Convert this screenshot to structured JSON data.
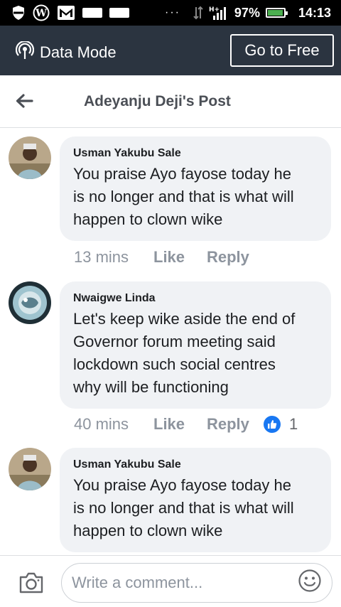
{
  "status_bar": {
    "dots": "···",
    "network": "H+",
    "battery": "97%",
    "battery_level": 0.97,
    "time": "14:13"
  },
  "data_mode": {
    "label": "Data Mode",
    "go_free_label": "Go to Free"
  },
  "header": {
    "title": "Adeyanju Deji's Post"
  },
  "comments": [
    {
      "author": "Usman Yakubu Sale",
      "text_lines": [
        "You praise Ayo fayose today he",
        "is no longer and that is what will",
        "happen to clown wike"
      ],
      "time": "13 mins",
      "like_label": "Like",
      "reply_label": "Reply"
    },
    {
      "author": "Nwaigwe Linda",
      "text_lines": [
        "Let's keep wike aside the end of",
        "Governor forum meeting said",
        "lockdown such social centres",
        "why will be functioning"
      ],
      "time": "40 mins",
      "like_label": "Like",
      "reply_label": "Reply",
      "reaction_count": "1"
    },
    {
      "author": "Usman Yakubu Sale",
      "text_lines": [
        "You praise Ayo fayose today he",
        "is no longer and that is what will",
        "happen to clown wike"
      ]
    }
  ],
  "composer": {
    "placeholder": "Write a comment..."
  },
  "colors": {
    "status_bar_bg": "#000000",
    "data_mode_bg": "#2b3440",
    "bubble_bg": "#f0f2f5",
    "accent_blue": "#1877f2",
    "muted_text": "#8d949e"
  }
}
